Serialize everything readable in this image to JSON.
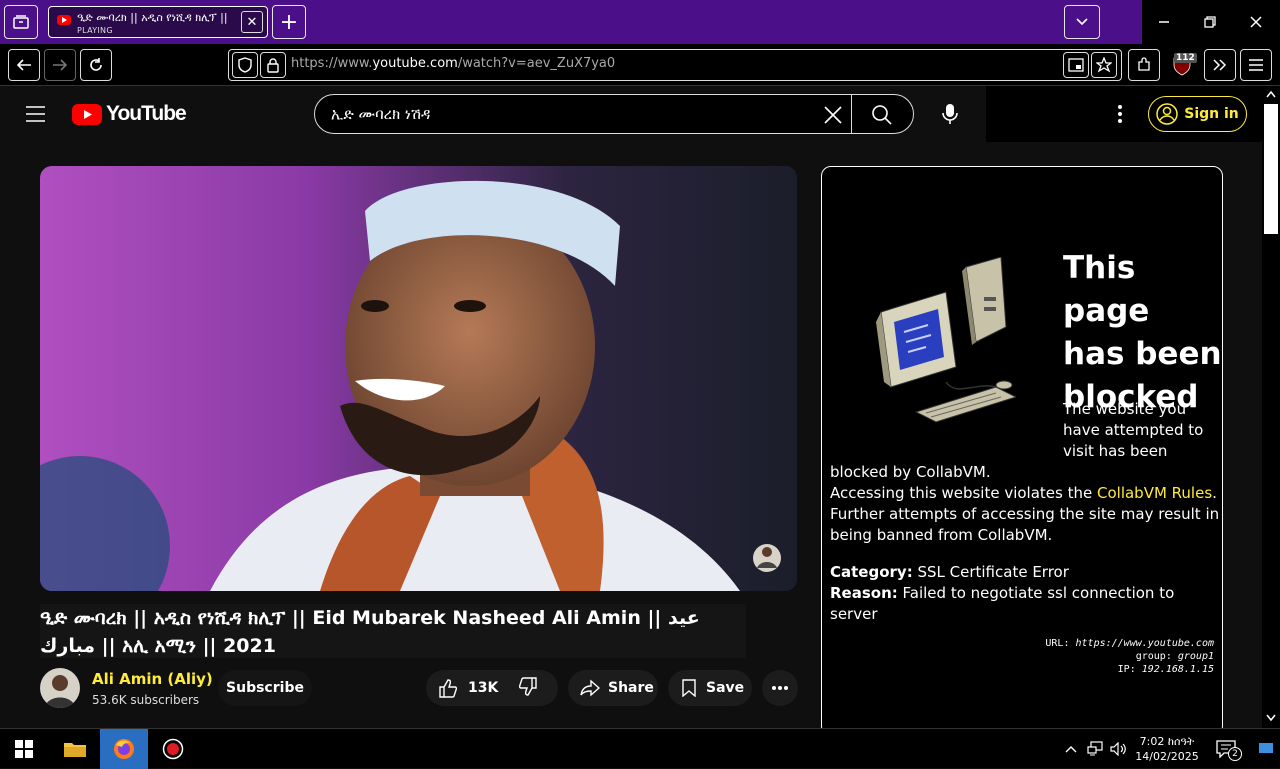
{
  "browser": {
    "tab": {
      "title": "ዒድ ሙባረክ || አዲስ የነሺዳ ክሊፕ || Eid Mubarek",
      "status": "PLAYING",
      "close_glyph": "✕"
    },
    "new_tab_glyph": "+",
    "list_all_tabs_glyph": "⌄",
    "url_prefix": "https://www.",
    "url_domain": "youtube.com",
    "url_path": "/watch?v=aev_ZuX7ya0",
    "extension_badge": "112"
  },
  "youtube": {
    "logo_text": "YouTube",
    "search_query": "ኢድ ሙባረክ ነሽዳ",
    "sign_in_label": "Sign in",
    "video": {
      "title": "ዒድ ሙባረክ || አዲስ የነሺዳ ክሊፕ || Eid Mubarek Nasheed Ali Amin || عيد مبارك || አሊ አሚን || 2021",
      "channel_name": "Ali Amin (Aliy)",
      "subscribers": "53.6K subscribers",
      "subscribe_label": "Subscribe",
      "likes": "13K",
      "share_label": "Share",
      "save_label": "Save"
    }
  },
  "blocked_page": {
    "heading_line1": "This page",
    "heading_line2": "has been",
    "heading_line3": "blocked",
    "msg_wrap_1": "The website you",
    "msg_wrap_2": "have attempted to",
    "msg_wrap_3": "visit has been",
    "msg_line_4": "blocked by CollabVM.",
    "msg_line_5_pre": "Accessing this website violates the ",
    "rules_link": "CollabVM Rules",
    "msg_line_5_post": ".",
    "msg_line_6": "Further attempts of accessing the site may result in",
    "msg_line_7": "being banned from CollabVM.",
    "category_label": "Category:",
    "category_value": " SSL Certificate Error",
    "reason_label": "Reason:",
    "reason_value": " Failed to negotiate ssl connection to server",
    "meta_url_label": "URL:",
    "meta_url": "https://www.youtube.com",
    "meta_group_label": "group:",
    "meta_group": "group1",
    "meta_ip_label": "IP:",
    "meta_ip": "192.168.1.15"
  },
  "taskbar": {
    "time": "7:02 ከሰዓት",
    "date": "14/02/2025",
    "notifications_count": "2"
  },
  "colors": {
    "tabbar_purple": "#4c0f8a",
    "youtube_red": "#ff0000",
    "accent_yellow": "#ffeb3b",
    "collabvm_link": "#ffeb3b"
  }
}
